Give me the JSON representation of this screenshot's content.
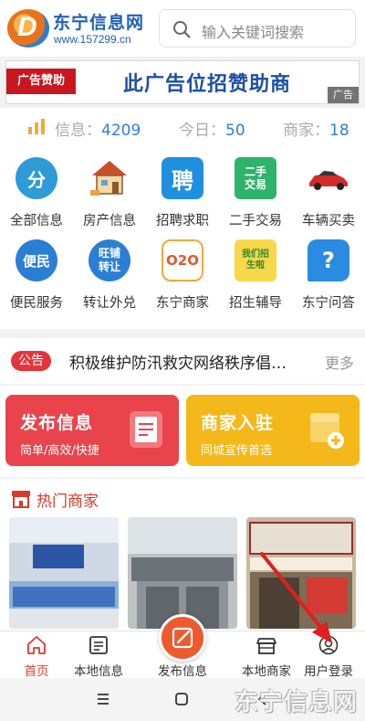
{
  "header": {
    "logo_name": "东宁信息网",
    "logo_url": "www.157299.cn",
    "search_placeholder": "输入关键词搜索"
  },
  "banner": {
    "tag": "广告赞助",
    "text": "此广告位招赞助商",
    "ad_badge": "广告"
  },
  "stats": [
    {
      "label": "信息：",
      "value": "4209"
    },
    {
      "label": "今日：",
      "value": "50"
    },
    {
      "label": "商家：",
      "value": "18"
    }
  ],
  "categories": [
    {
      "label": "全部信息",
      "icon": "all-info-icon",
      "glyph": "分"
    },
    {
      "label": "房产信息",
      "icon": "house-icon",
      "glyph": ""
    },
    {
      "label": "招聘求职",
      "icon": "job-icon",
      "glyph": "聘"
    },
    {
      "label": "二手交易",
      "icon": "second-hand-icon",
      "glyph": "二手交易"
    },
    {
      "label": "车辆买卖",
      "icon": "car-icon",
      "glyph": ""
    },
    {
      "label": "便民服务",
      "icon": "convenience-icon",
      "glyph": "便民"
    },
    {
      "label": "转让外兑",
      "icon": "transfer-icon",
      "glyph": "旺铺转让"
    },
    {
      "label": "东宁商家",
      "icon": "o2o-icon",
      "glyph": "O2O"
    },
    {
      "label": "招生辅导",
      "icon": "enrollment-icon",
      "glyph": "我们招生啦"
    },
    {
      "label": "东宁问答",
      "icon": "qa-icon",
      "glyph": "?"
    }
  ],
  "notice": {
    "tag": "公告",
    "text": "积极维护防汛救灾网络秩序倡…",
    "more": "更多"
  },
  "actions": {
    "publish": {
      "title": "发布信息",
      "sub": "简单/高效/快捷"
    },
    "merchant": {
      "title": "商家入驻",
      "sub": "同城宣传首选"
    }
  },
  "hot": {
    "title": "热门商家"
  },
  "nav": [
    {
      "label": "首页",
      "icon": "home-icon"
    },
    {
      "label": "本地信息",
      "icon": "local-info-icon"
    },
    {
      "label": "发布信息",
      "icon": "publish-icon"
    },
    {
      "label": "本地商家",
      "icon": "shop-icon"
    },
    {
      "label": "用户登录",
      "icon": "user-icon"
    }
  ],
  "watermark": "东宁信息网",
  "colors": {
    "accent_red": "#e0372f",
    "brand_blue": "#1f5fb8",
    "stat_blue": "#2f7fd7",
    "publish_card": "#e9434b",
    "merchant_card": "#f5b81a"
  }
}
